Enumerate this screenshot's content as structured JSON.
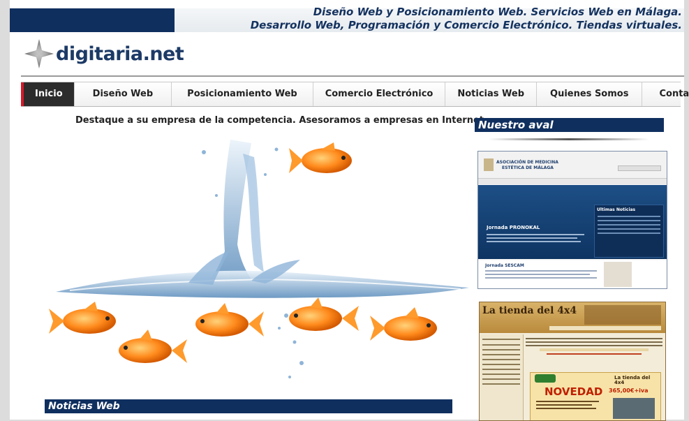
{
  "header": {
    "tagline_line1": "Diseño Web y Posicionamiento Web. Servicios Web en Málaga.",
    "tagline_line2": "Desarrollo Web, Programación y Comercio Electrónico. Tiendas virtuales.",
    "logo_text": "digitaria.net"
  },
  "nav": {
    "items": [
      {
        "label": "Inicio"
      },
      {
        "label": "Diseño Web"
      },
      {
        "label": "Posicionamiento Web"
      },
      {
        "label": "Comercio Electrónico"
      },
      {
        "label": "Noticias Web"
      },
      {
        "label": "Quienes Somos"
      },
      {
        "label": "Contacto"
      }
    ]
  },
  "main": {
    "headline": "Destaque a su empresa de la competencia. Asesoramos a empresas en Internet.",
    "news_title": "Noticias Web"
  },
  "sidebar": {
    "title": "Nuestro aval",
    "shot1": {
      "org_line1": "ASOCIACIÓN DE MEDICINA",
      "org_line2": "ESTÉTICA DE MÁLAGA",
      "news_box_title": "Ultimas Noticias",
      "article1": "Jornada PRONOKAL",
      "article2": "Jornada SESCAM"
    },
    "shot2": {
      "store_title": "La tienda del 4x4",
      "promo": "NOVEDAD",
      "promo_price": "365,00€+iva",
      "promo_brand": "La tienda del 4x4"
    }
  },
  "colors": {
    "brand_navy": "#0f2f5f",
    "nav_active_bg": "#2c2c2c",
    "nav_active_accent": "#d4192a",
    "fish_orange": "#ff8a1c",
    "water_blue": "#6f9cc4"
  }
}
